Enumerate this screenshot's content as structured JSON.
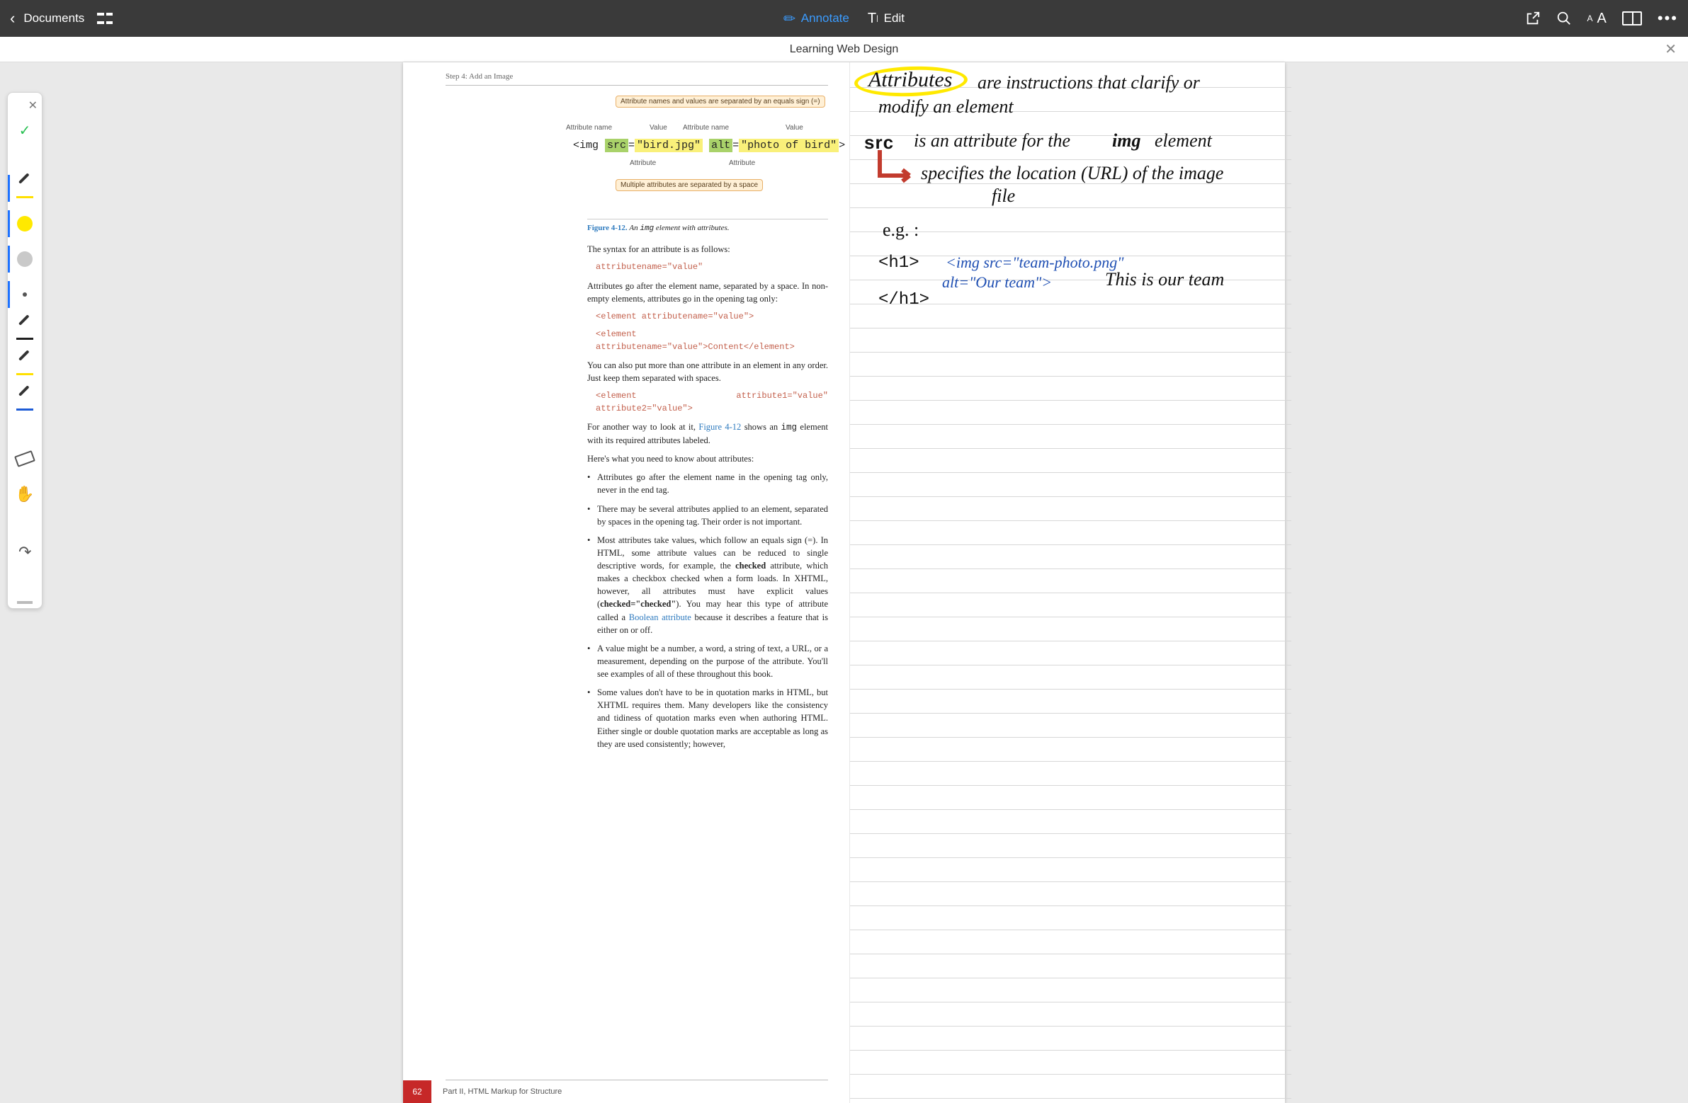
{
  "toolbar": {
    "back_label": "Documents",
    "annotate_label": "Annotate",
    "edit_label": "Edit"
  },
  "subheader": {
    "title": "Learning Web Design"
  },
  "page_left": {
    "step_header": "Step 4: Add an Image",
    "diagram": {
      "callout_top": "Attribute names and values are separated by an equals sign (=)",
      "callout_bottom": "Multiple attributes are separated by a space",
      "lbl_attr_name": "Attribute name",
      "lbl_value": "Value",
      "lbl_attribute": "Attribute",
      "code_prefix": "<img ",
      "code_src": "src",
      "code_eq": "=",
      "code_srcval": "\"bird.jpg\"",
      "code_alt": "alt",
      "code_altval": "\"photo of bird\"",
      "code_suffix": ">"
    },
    "fig_num": "Figure 4-12.",
    "fig_text_a": "An ",
    "fig_mono": "img",
    "fig_text_b": " element with attributes.",
    "p1": "The syntax for an attribute is as follows:",
    "c1": "attributename=\"value\"",
    "p2": "Attributes go after the element name, separated by a space. In non-empty elements, attributes go in the opening tag only:",
    "c2": "<element attributename=\"value\">",
    "c3": "<element attributename=\"value\">Content</element>",
    "p3": "You can also put more than one attribute in an element in any order. Just keep them separated with spaces.",
    "c4": "<element attribute1=\"value\" attribute2=\"value\">",
    "p4a": "For another way to look at it, ",
    "p4link": "Figure 4-12",
    "p4b": " shows an ",
    "p4mono": "img",
    "p4c": " element with its required attributes labeled.",
    "p5": "Here's what you need to know about attributes:",
    "li1": "Attributes go after the element name in the opening tag only, never in the end tag.",
    "li2": "There may be several attributes applied to an element, separated by spaces in the opening tag. Their order is not important.",
    "li3a": "Most attributes take values, which follow an equals sign (=). In HTML, some attribute values can be reduced to single descriptive words, for example, the ",
    "li3b": "checked",
    "li3c": " attribute, which makes a checkbox checked when a form loads. In XHTML, however, all attributes must have explicit values (",
    "li3d": "checked=\"checked\"",
    "li3e": "). You may hear this type of attribute called a ",
    "li3link": "Boolean attribute",
    "li3f": " because it describes a feature that is either on or off.",
    "li4": "A value might be a number, a word, a string of text, a URL, or a measurement, depending on the purpose of the attribute. You'll see examples of all of these throughout this book.",
    "li5": "Some values don't have to be in quotation marks in HTML, but XHTML requires them. Many developers like the consistency and tidiness of quotation marks even when authoring HTML. Either single or double quotation marks are acceptable as long as they are used consistently; however,",
    "page_number": "62",
    "footer": "Part  II, HTML Markup for Structure"
  },
  "notes": {
    "l1a": "Attributes",
    "l1b": "are instructions that clarify or",
    "l2": "modify an element",
    "l3a": "src",
    "l3b": "is an attribute for the",
    "l3c": "img",
    "l3d": "element",
    "l4": "specifies the location (URL) of the image",
    "l4b": "file",
    "l5": "e.g. :",
    "l6": "<h1>",
    "l6b": "<img src=\"team-photo.png\"",
    "l7": "alt=\"Our team\">",
    "l7b": "This is our team",
    "l8": "</h1>"
  }
}
